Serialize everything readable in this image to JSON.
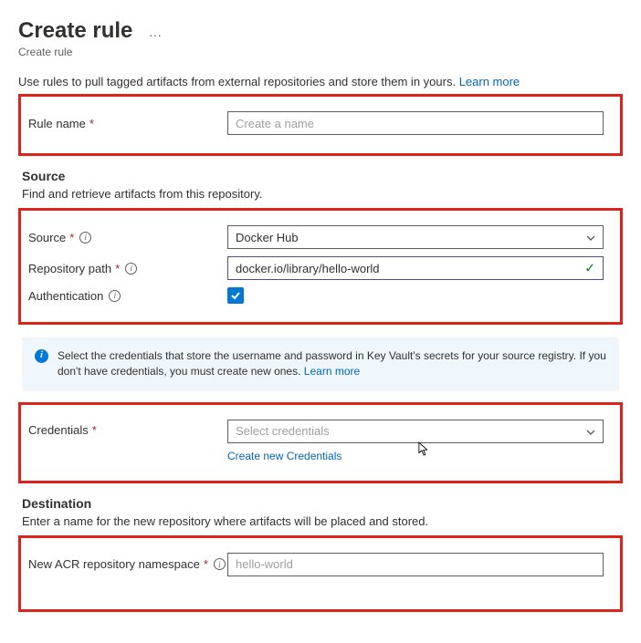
{
  "header": {
    "title": "Create rule",
    "subtitle": "Create rule"
  },
  "intro": {
    "text": "Use rules to pull tagged artifacts from external repositories and store them in yours.",
    "learn_more": "Learn more"
  },
  "fields": {
    "rule_name": {
      "label": "Rule name",
      "placeholder": "Create a name"
    }
  },
  "source_section": {
    "title": "Source",
    "desc": "Find and retrieve artifacts from this repository.",
    "source": {
      "label": "Source",
      "value": "Docker Hub"
    },
    "repo_path": {
      "label": "Repository path",
      "value": "docker.io/library/hello-world"
    },
    "auth": {
      "label": "Authentication",
      "checked": true
    }
  },
  "info_panel": {
    "text": "Select the credentials that store the username and password in Key Vault's secrets for your source registry. If you don't have credentials, you must create new ones.",
    "learn_more": "Learn more"
  },
  "credentials": {
    "label": "Credentials",
    "placeholder": "Select credentials",
    "create_link": "Create new Credentials"
  },
  "destination": {
    "title": "Destination",
    "desc": "Enter a name for the new repository where artifacts will be placed and stored.",
    "namespace": {
      "label": "New ACR repository namespace",
      "placeholder": "hello-world"
    }
  }
}
